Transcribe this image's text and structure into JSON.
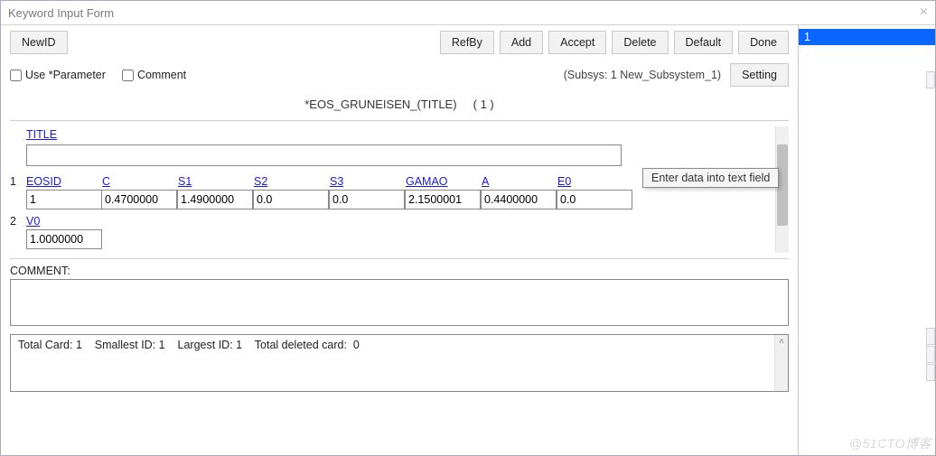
{
  "window": {
    "title": "Keyword Input Form"
  },
  "toolbar": {
    "newid": "NewID",
    "refby": "RefBy",
    "add": "Add",
    "accept": "Accept",
    "delete": "Delete",
    "default": "Default",
    "done": "Done"
  },
  "options": {
    "use_parameter_label": "Use *Parameter",
    "use_parameter_checked": false,
    "comment_label": "Comment",
    "comment_checked": false,
    "subsys_text": "(Subsys: 1 New_Subsystem_1)",
    "setting_label": "Setting"
  },
  "keyword": {
    "name": "*EOS_GRUNEISEN_(TITLE)",
    "count_text": "( 1 )"
  },
  "title_field": {
    "link": "TITLE",
    "value": ""
  },
  "cards": [
    {
      "index": "1",
      "fields": [
        {
          "name": "EOSID",
          "value": "1"
        },
        {
          "name": "C",
          "value": "0.4700000"
        },
        {
          "name": "S1",
          "value": "1.4900000"
        },
        {
          "name": "S2",
          "value": "0.0"
        },
        {
          "name": "S3",
          "value": "0.0"
        },
        {
          "name": "GAMAO",
          "value": "2.1500001"
        },
        {
          "name": "A",
          "value": "0.4400000"
        },
        {
          "name": "E0",
          "value": "0.0"
        }
      ]
    },
    {
      "index": "2",
      "fields": [
        {
          "name": "V0",
          "value": "1.0000000"
        }
      ]
    }
  ],
  "tooltip_text": "Enter data into text field",
  "comment": {
    "label": "COMMENT:",
    "value": ""
  },
  "status": {
    "total_card_label": "Total Card:",
    "total_card": "1",
    "smallest_id_label": "Smallest ID:",
    "smallest_id": "1",
    "largest_id_label": "Largest ID:",
    "largest_id": "1",
    "total_deleted_label": "Total deleted card:",
    "total_deleted": "0"
  },
  "right_list": {
    "items": [
      "1"
    ],
    "selected_index": 0
  },
  "watermark": "@51CTO博客"
}
